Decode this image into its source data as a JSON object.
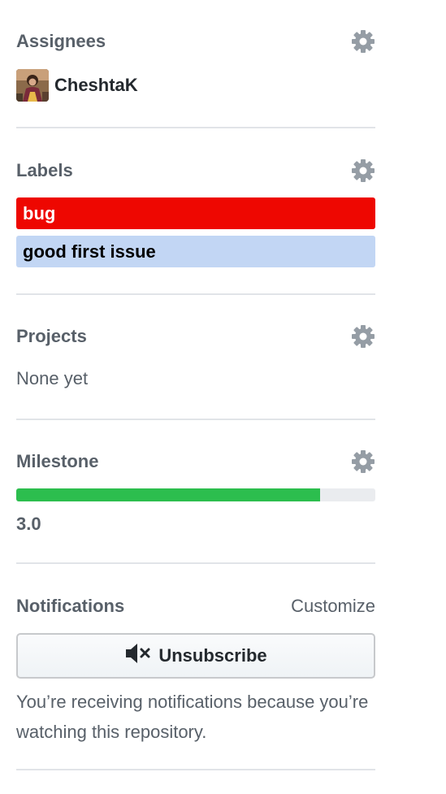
{
  "assignees": {
    "heading": "Assignees",
    "users": [
      {
        "name": "CheshtaK"
      }
    ]
  },
  "labels": {
    "heading": "Labels",
    "items": [
      {
        "name": "bug",
        "color": "#ee0701",
        "text_color": "#ffffff"
      },
      {
        "name": "good first issue",
        "color": "#c2d6f4",
        "text_color": "#000000"
      }
    ]
  },
  "projects": {
    "heading": "Projects",
    "empty_text": "None yet"
  },
  "milestone": {
    "heading": "Milestone",
    "title": "3.0",
    "progress_fraction": 0.846,
    "progress_color": "#2cbe4e"
  },
  "notifications": {
    "heading": "Notifications",
    "customize_label": "Customize",
    "button_label": "Unsubscribe",
    "button_icon": "mute-icon",
    "note": "You’re receiving notifications because you’re watching this repository."
  },
  "icons": {
    "settings": "gear-icon"
  }
}
